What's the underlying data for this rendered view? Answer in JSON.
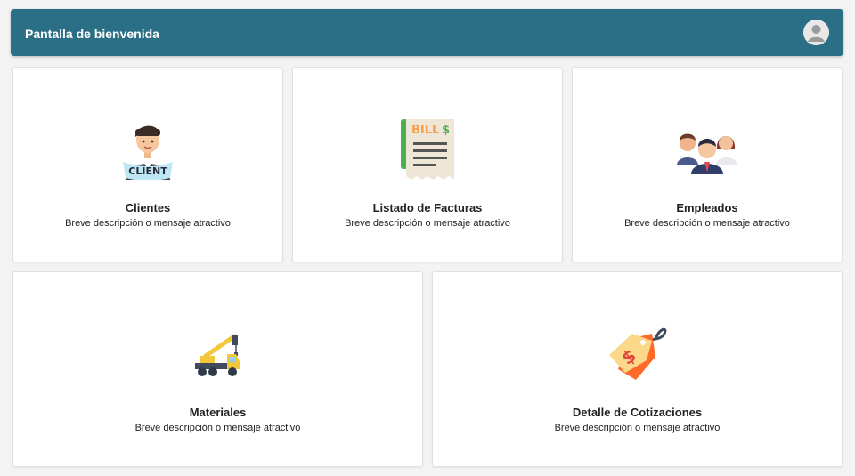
{
  "header": {
    "title": "Pantalla de bienvenida"
  },
  "cards": [
    {
      "title": "Clientes",
      "description": "Breve descripción o mensaje atractivo",
      "icon": "client-icon",
      "icon_text": "CLIENT"
    },
    {
      "title": "Listado de Facturas",
      "description": "Breve descripción o mensaje atractivo",
      "icon": "bill-icon",
      "icon_text": "BILL"
    },
    {
      "title": "Empleados",
      "description": "Breve descripción o mensaje atractivo",
      "icon": "employees-icon"
    },
    {
      "title": "Materiales",
      "description": "Breve descripción o mensaje atractivo",
      "icon": "crane-truck-icon"
    },
    {
      "title": "Detalle de Cotizaciones",
      "description": "Breve descripción o mensaje atractivo",
      "icon": "price-tag-icon"
    }
  ],
  "colors": {
    "header": "#2a6f85",
    "background": "#f3f3f3",
    "card": "#ffffff"
  }
}
